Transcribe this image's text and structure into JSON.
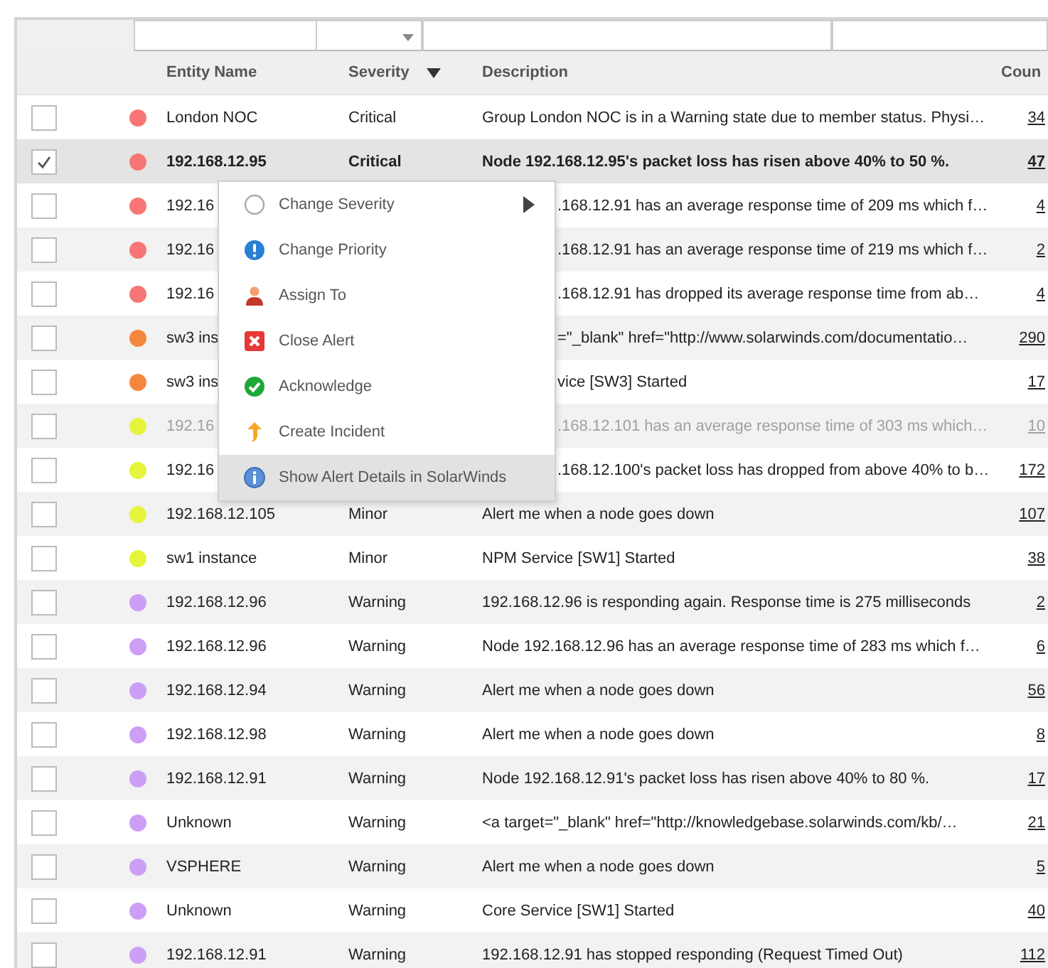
{
  "filters": [
    {
      "kind": "text"
    },
    {
      "kind": "dropdown"
    },
    {
      "kind": "text"
    },
    {
      "kind": "text"
    }
  ],
  "columns": [
    {
      "label": "Entity Name",
      "sorted": false
    },
    {
      "label": "Severity",
      "sorted": true
    },
    {
      "label": "Description",
      "sorted": false
    },
    {
      "label": "Coun",
      "sorted": false
    }
  ],
  "rows": [
    {
      "checked": false,
      "selected": false,
      "dimmed": false,
      "color": "#f87575",
      "entity": "London NOC",
      "severity": "Critical",
      "description": "Group London NOC is in a Warning state due to member status. Physi…",
      "count": "34"
    },
    {
      "checked": true,
      "selected": true,
      "dimmed": false,
      "color": "#f87575",
      "entity": "192.168.12.95",
      "severity": "Critical",
      "description": "Node 192.168.12.95's packet loss has risen above 40% to 50 %.",
      "count": "47"
    },
    {
      "checked": false,
      "selected": false,
      "dimmed": false,
      "color": "#f87575",
      "entity": "192.16",
      "description": ".168.12.91 has an average response time of 209 ms which f…",
      "count": "4"
    },
    {
      "checked": false,
      "selected": false,
      "dimmed": false,
      "color": "#f87575",
      "entity": "192.16",
      "description": ".168.12.91 has an average response time of 219 ms which f…",
      "count": "2"
    },
    {
      "checked": false,
      "selected": false,
      "dimmed": false,
      "color": "#f87575",
      "entity": "192.16",
      "description": ".168.12.91 has dropped its average response time from ab…",
      "count": "4"
    },
    {
      "checked": false,
      "selected": false,
      "dimmed": false,
      "color": "#f5873c",
      "entity": "sw3 ins",
      "description": "=\"_blank\" href=\"http://www.solarwinds.com/documentatio…",
      "count": "290"
    },
    {
      "checked": false,
      "selected": false,
      "dimmed": false,
      "color": "#f5873c",
      "entity": "sw3 ins",
      "description": "vice [SW3] Started",
      "count": "17"
    },
    {
      "checked": false,
      "selected": false,
      "dimmed": true,
      "color": "#e4f53c",
      "entity": "192.16",
      "description": ".168.12.101 has an average response time of 303 ms which…",
      "count": "10"
    },
    {
      "checked": false,
      "selected": false,
      "dimmed": false,
      "color": "#e4f53c",
      "entity": "192.16",
      "description": ".168.12.100's packet loss has dropped from above 40% to b…",
      "count": "172"
    },
    {
      "checked": false,
      "selected": false,
      "dimmed": false,
      "color": "#e4f53c",
      "entity": "192.168.12.105",
      "severity": "Minor",
      "description": "Alert me when a node goes down",
      "count": "107"
    },
    {
      "checked": false,
      "selected": false,
      "dimmed": false,
      "color": "#e4f53c",
      "entity": "sw1 instance",
      "severity": "Minor",
      "description": "NPM Service [SW1] Started",
      "count": "38"
    },
    {
      "checked": false,
      "selected": false,
      "dimmed": false,
      "color": "#cc9ef5",
      "entity": "192.168.12.96",
      "severity": "Warning",
      "description": "192.168.12.96 is responding again. Response time is 275 milliseconds",
      "count": "2"
    },
    {
      "checked": false,
      "selected": false,
      "dimmed": false,
      "color": "#cc9ef5",
      "entity": "192.168.12.96",
      "severity": "Warning",
      "description": "Node 192.168.12.96 has an average response time of 283 ms which f…",
      "count": "6"
    },
    {
      "checked": false,
      "selected": false,
      "dimmed": false,
      "color": "#cc9ef5",
      "entity": "192.168.12.94",
      "severity": "Warning",
      "description": "Alert me when a node goes down",
      "count": "56"
    },
    {
      "checked": false,
      "selected": false,
      "dimmed": false,
      "color": "#cc9ef5",
      "entity": "192.168.12.98",
      "severity": "Warning",
      "description": "Alert me when a node goes down",
      "count": "8"
    },
    {
      "checked": false,
      "selected": false,
      "dimmed": false,
      "color": "#cc9ef5",
      "entity": "192.168.12.91",
      "severity": "Warning",
      "description": "Node 192.168.12.91's packet loss has risen above 40% to 80 %.",
      "count": "17"
    },
    {
      "checked": false,
      "selected": false,
      "dimmed": false,
      "color": "#cc9ef5",
      "entity": "Unknown",
      "severity": "Warning",
      "description": "<a target=\"_blank\" href=\"http://knowledgebase.solarwinds.com/kb/…",
      "count": "21"
    },
    {
      "checked": false,
      "selected": false,
      "dimmed": false,
      "color": "#cc9ef5",
      "entity": "VSPHERE",
      "severity": "Warning",
      "description": "Alert me when a node goes down",
      "count": "5"
    },
    {
      "checked": false,
      "selected": false,
      "dimmed": false,
      "color": "#cc9ef5",
      "entity": "Unknown",
      "severity": "Warning",
      "description": "Core Service [SW1] Started",
      "count": "40"
    },
    {
      "checked": false,
      "selected": false,
      "dimmed": false,
      "color": "#cc9ef5",
      "entity": "192.168.12.91",
      "severity": "Warning",
      "description": "192.168.12.91 has stopped responding (Request Timed Out)",
      "count": "112"
    }
  ],
  "context_menu": {
    "items": [
      {
        "kind": "severity",
        "label": "Change Severity",
        "submenu": true,
        "selected": false
      },
      {
        "kind": "priority",
        "label": "Change Priority",
        "submenu": false,
        "selected": false
      },
      {
        "kind": "assign",
        "label": "Assign To",
        "submenu": false,
        "selected": false
      },
      {
        "kind": "close",
        "label": "Close Alert",
        "submenu": false,
        "selected": false
      },
      {
        "kind": "acknowledge",
        "label": "Acknowledge",
        "submenu": false,
        "selected": false
      },
      {
        "kind": "incident",
        "label": "Create Incident",
        "submenu": false,
        "selected": false
      },
      {
        "kind": "details",
        "label": "Show Alert Details in SolarWinds",
        "submenu": false,
        "selected": true
      }
    ]
  }
}
